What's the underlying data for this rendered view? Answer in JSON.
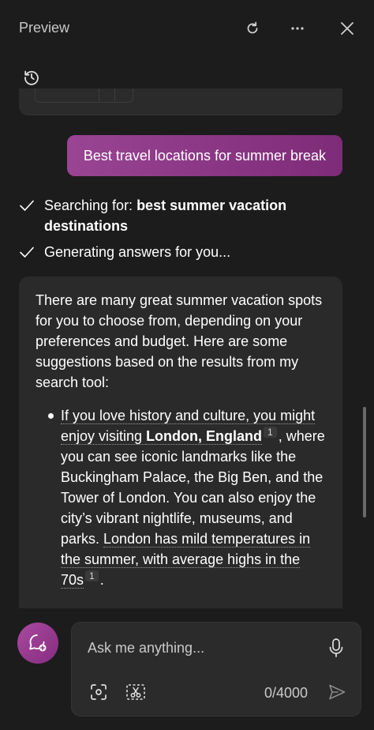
{
  "window": {
    "title": "Preview",
    "refresh_icon": "refresh-icon",
    "more_icon": "more-options-icon",
    "close_icon": "close-icon",
    "history_icon": "history-icon"
  },
  "user_message": "Best travel locations for summer break",
  "status": [
    {
      "prefix": "Searching for: ",
      "bold": "best summer vacation destinations"
    },
    {
      "prefix": "Generating answers for you...",
      "bold": ""
    }
  ],
  "answer": {
    "intro": "There are many great summer vacation spots for you to choose from, depending on your preferences and budget. Here are some suggestions based on the results from my search tool:",
    "item1": {
      "part1": "If you love history and culture, you might enjoy visiting ",
      "bold": "London, England",
      "cite1": "1",
      "part2": ", where you can see iconic landmarks like the Buckingham Palace, the Big Ben, and the Tower of London. You can also enjoy the city’s vibrant nightlife, museums, and parks. ",
      "cited_sentence": "London has mild temperatures in the summer, with average highs in the 70s",
      "cite2": "1",
      "end": "."
    }
  },
  "composer": {
    "placeholder": "Ask me anything...",
    "counter": "0/4000",
    "new_topic_icon": "new-topic-icon",
    "mic_icon": "microphone-icon",
    "camera_icon": "camera-capture-icon",
    "screenshot_icon": "snip-icon",
    "send_icon": "send-icon"
  },
  "colors": {
    "background": "#1c1c1c",
    "card": "#2a2a2a",
    "accent": "#8e3a89"
  }
}
